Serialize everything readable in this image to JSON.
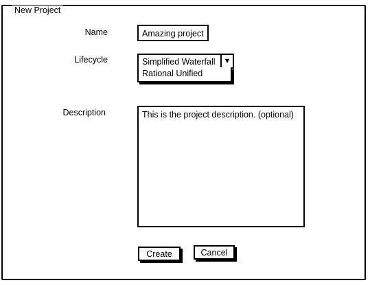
{
  "group": {
    "title": "New Project"
  },
  "form": {
    "name_label": "Name",
    "name_value": "Amazing project",
    "lifecycle_label": "Lifecycle",
    "lifecycle_selected": "Simplified Waterfall",
    "lifecycle_options": [
      "Rational Unified"
    ],
    "description_label": "Description",
    "description_value": "This is the project description. (optional)"
  },
  "actions": {
    "create_label": "Create",
    "cancel_label": "Cancel"
  },
  "icons": {
    "dropdown": "triangle-down-icon"
  }
}
